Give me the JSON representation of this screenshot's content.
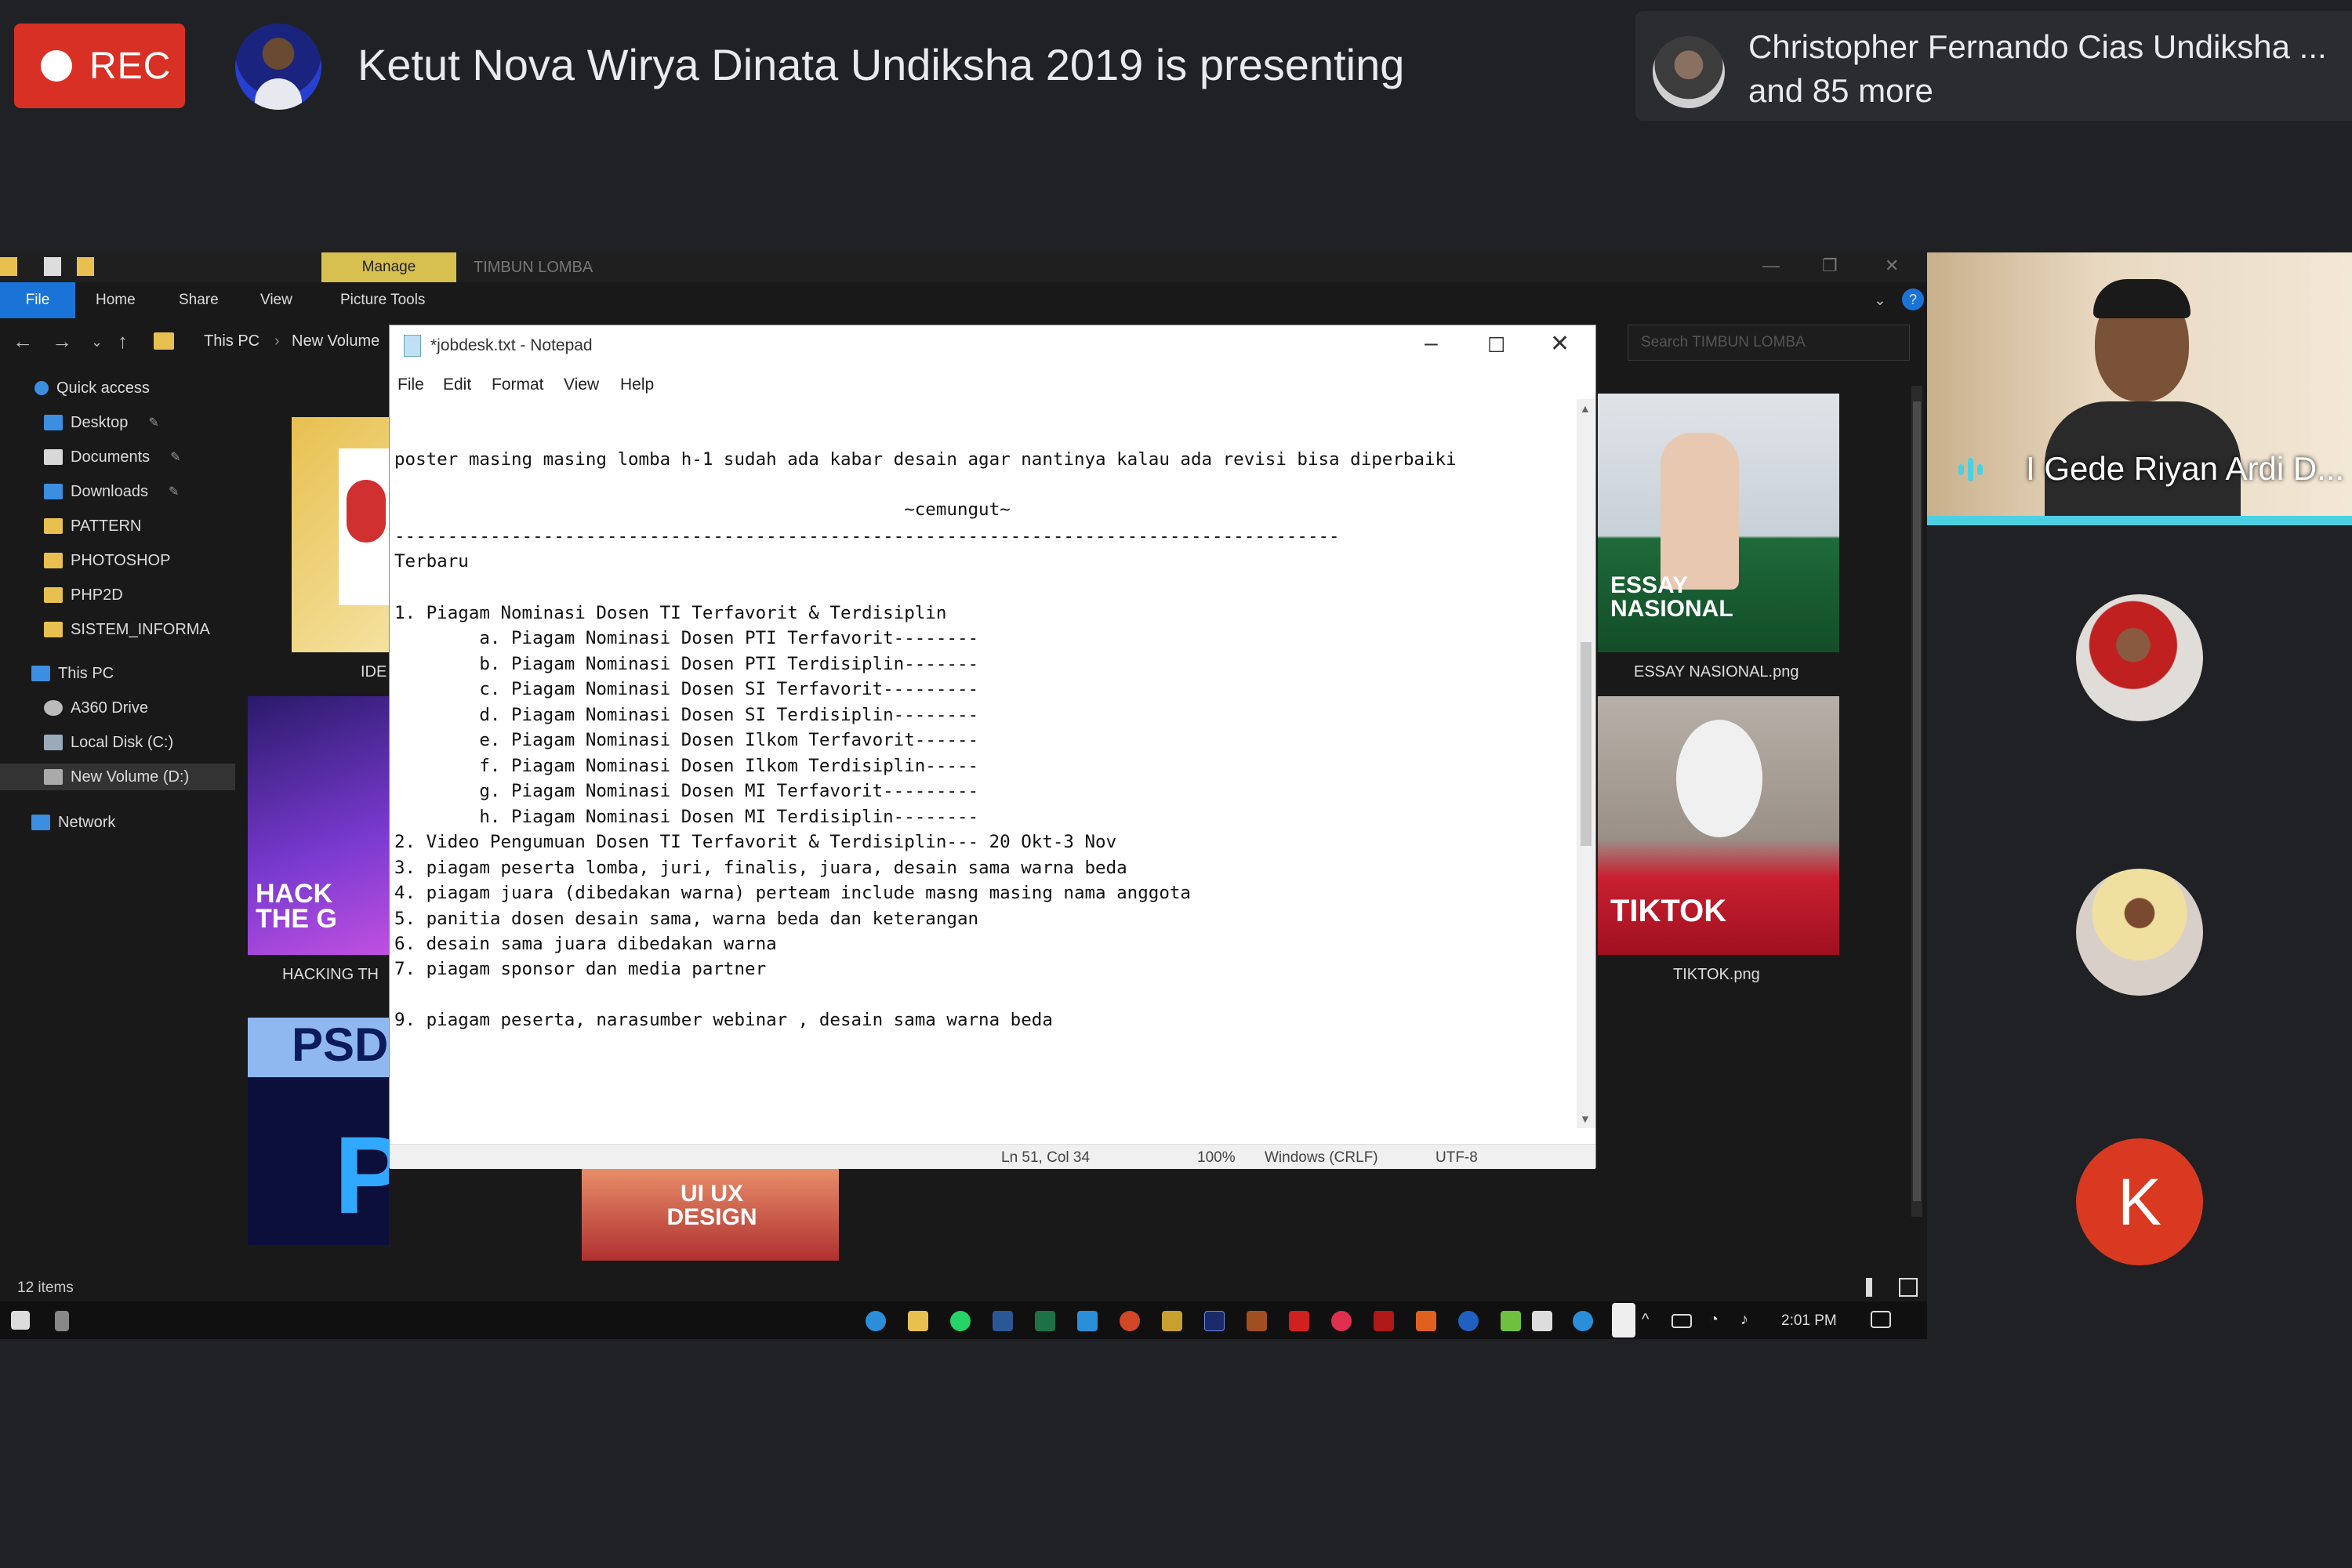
{
  "meet": {
    "rec_label": "REC",
    "presenting_text": "Ketut Nova Wirya Dinata Undiksha 2019 is presenting",
    "participants_line1": "Christopher Fernando Cias Undiksha ...",
    "participants_line2": "and 85 more",
    "self_name": "I Gede Riyan Ardi D...",
    "avatar_letter": "K",
    "accent_color": "#4dd0e1",
    "rec_color": "#d93025"
  },
  "explorer": {
    "window_title": "TIMBUN LOMBA",
    "manage_tab": "Manage",
    "ribbon_tabs": [
      "File",
      "Home",
      "Share",
      "View",
      "Picture Tools"
    ],
    "breadcrumb": [
      "This PC",
      "New Volume"
    ],
    "search_placeholder": "Search TIMBUN LOMBA",
    "nav": [
      "Quick access",
      "Desktop",
      "Documents",
      "Downloads",
      "PATTERN",
      "PHOTOSHOP",
      "PHP2D",
      "SISTEM_INFORMA",
      "This PC",
      "A360 Drive",
      "Local Disk (C:)",
      "New Volume (D:)",
      "Network"
    ],
    "files": {
      "essay": "ESSAY NASIONAL.png",
      "tiktok": "TIKTOK.png",
      "hacking": "HACKING TH",
      "ide": "IDE"
    },
    "thumb_text": {
      "essay_title": "ESSAY NASIONAL",
      "tiktok_title": "TIKTOK",
      "hacking_title": "HACK THE G",
      "psd": "PSD",
      "ps": "Ps",
      "uiux": "UI UX DESIGN"
    },
    "status_items": "12 items",
    "clock": "2:01 PM"
  },
  "notepad": {
    "title": "*jobdesk.txt - Notepad",
    "menu": [
      "File",
      "Edit",
      "Format",
      "View",
      "Help"
    ],
    "lines": [
      "poster masing masing lomba h-1 sudah ada kabar desain agar nantinya kalau ada revisi bisa diperbaiki",
      "                                                ~cemungut~",
      "-----------------------------------------------------------------------------------------",
      "Terbaru",
      "1. Piagam Nominasi Dosen TI Terfavorit & Terdisiplin",
      "        a. Piagam Nominasi Dosen PTI Terfavorit--------",
      "        b. Piagam Nominasi Dosen PTI Terdisiplin-------",
      "        c. Piagam Nominasi Dosen SI Terfavorit---------",
      "        d. Piagam Nominasi Dosen SI Terdisiplin--------",
      "        e. Piagam Nominasi Dosen Ilkom Terfavorit------",
      "        f. Piagam Nominasi Dosen Ilkom Terdisiplin-----",
      "        g. Piagam Nominasi Dosen MI Terfavorit---------",
      "        h. Piagam Nominasi Dosen MI Terdisiplin--------",
      "2. Video Pengumuan Dosen TI Terfavorit & Terdisiplin--- 20 Okt-3 Nov",
      "3. piagam peserta lomba, juri, finalis, juara, desain sama warna beda",
      "4. piagam juara (dibedakan warna) perteam include masng masing nama anggota",
      "5. panitia dosen desain sama, warna beda dan keterangan",
      "6. desain sama juara dibedakan warna",
      "7. piagam sponsor dan media partner",
      "",
      "9. piagam peserta, narasumber webinar , desain sama warna beda"
    ],
    "status": {
      "position": "Ln 51, Col 34",
      "zoom": "100%",
      "eol": "Windows (CRLF)",
      "encoding": "UTF-8"
    }
  }
}
